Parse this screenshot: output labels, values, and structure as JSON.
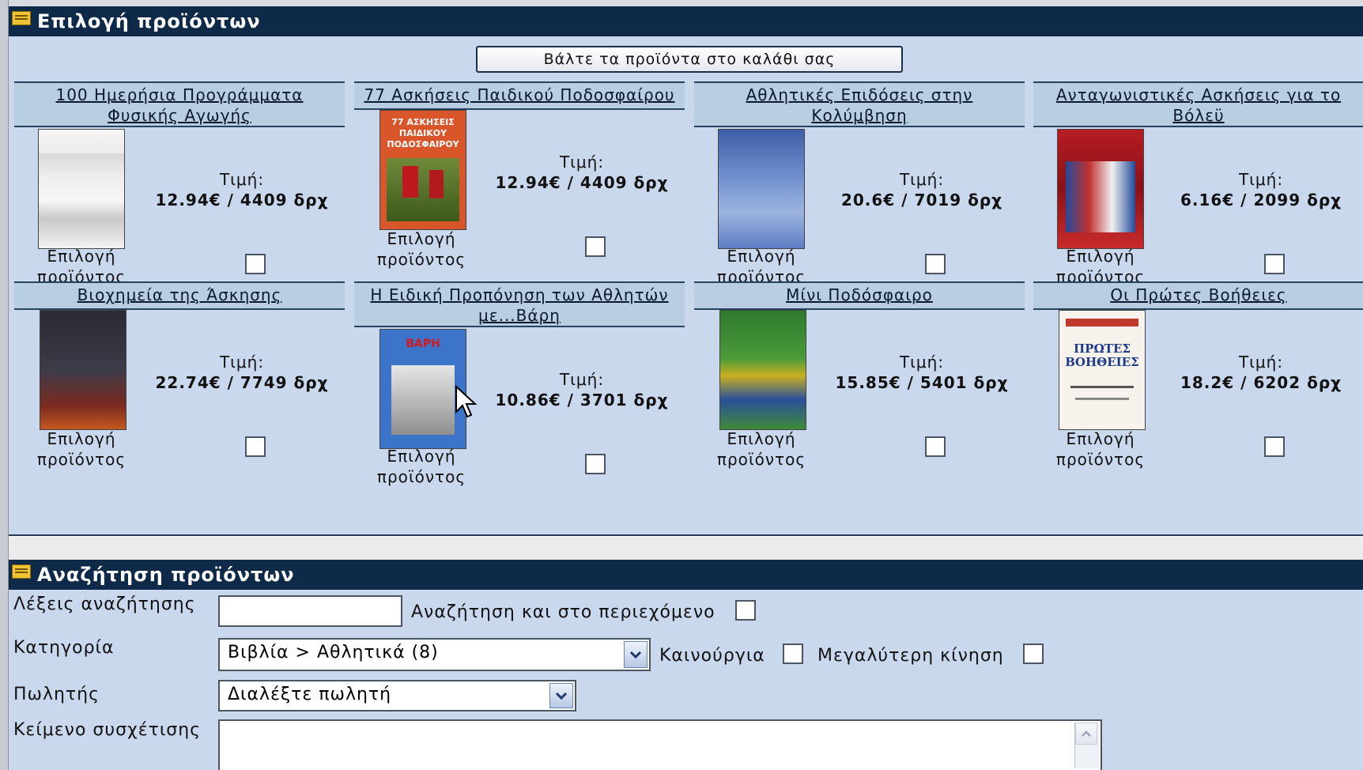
{
  "panel_products": {
    "title": "Επιλογή προϊόντων",
    "cart_button": "Βάλτε τα προϊόντα στο καλάθι σας",
    "price_label": "Τιμή:",
    "select_label_line1": "Επιλογή",
    "select_label_line2": "προϊόντος",
    "products": [
      {
        "title": "100 Ημερήσια Προγράμματα Φυσικής Αγωγής",
        "price": "12.94€ / 4409 δρχ",
        "selected": false
      },
      {
        "title": "77 Ασκήσεις Παιδικού Ποδοσφαίρου",
        "price": "12.94€ / 4409 δρχ",
        "selected": false,
        "cover_text": "77 ΑΣΚΗΣΕΙΣ ΠΑΙΔΙΚΟΥ ΠΟΔΟΣΦΑΙΡΟΥ"
      },
      {
        "title": "Αθλητικές Επιδόσεις στην Κολύμβηση",
        "price": "20.6€ / 7019 δρχ",
        "selected": false
      },
      {
        "title": "Ανταγωνιστικές Ασκήσεις για το Βόλεϋ",
        "price": "6.16€ / 2099 δρχ",
        "selected": false
      },
      {
        "title": "Βιοχημεία της Άσκησης",
        "price": "22.74€ / 7749 δρχ",
        "selected": false
      },
      {
        "title": "Η Ειδική Προπόνηση των Αθλητών με...Βάρη",
        "price": "10.86€ / 3701 δρχ",
        "selected": false,
        "cover_text": "ΒΑΡΗ"
      },
      {
        "title": "Μίνι Ποδόσφαιρο",
        "price": "15.85€ / 5401 δρχ",
        "selected": false
      },
      {
        "title": "Οι Πρώτες Βοήθειες",
        "price": "18.2€ / 6202 δρχ",
        "selected": false,
        "cover_text": "ΠΡΩΤΕΣ ΒΟΗΘΕΙΕΣ"
      }
    ]
  },
  "panel_search": {
    "title": "Αναζήτηση προϊόντων",
    "keywords_label": "Λέξεις αναζήτησης",
    "keywords_value": "",
    "search_content_label": "Αναζήτηση και στο περιεχόμενο",
    "category_label": "Κατηγορία",
    "category_value": "Βιβλία > Αθλητικά (8)",
    "new_label": "Καινούργια",
    "most_traffic_label": "Μεγαλύτερη κίνηση",
    "seller_label": "Πωλητής",
    "seller_value": "Διαλέξτε πωλητή",
    "related_text_label": "Κείμενο συσχέτισης",
    "related_text_value": ""
  },
  "colors": {
    "header_bg": "#0f2a48",
    "panel_bg": "#cad8ee",
    "card_title_bg": "#b9cde3"
  }
}
